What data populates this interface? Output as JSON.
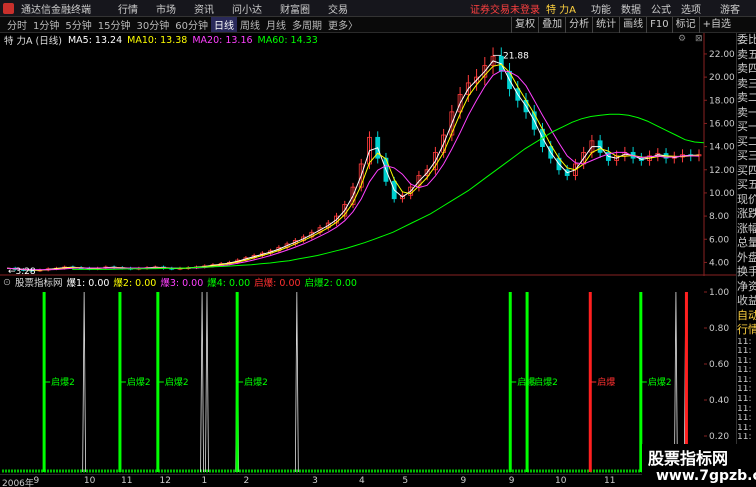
{
  "app": {
    "title": "通达信金融终端",
    "menus": [
      "行情",
      "市场",
      "资讯",
      "问小达",
      "财富圈",
      "交易"
    ],
    "login_status": "证券交易未登录",
    "stock_name": "特 力A",
    "right_menus": [
      "功能",
      "数据",
      "公式",
      "选项"
    ],
    "guest": "游客"
  },
  "toolbar": {
    "periods": [
      "分时",
      "1分钟",
      "5分钟",
      "15分钟",
      "30分钟",
      "60分钟",
      "日线",
      "周线",
      "月线",
      "多周期",
      "更多"
    ],
    "active_period": "日线",
    "more_suffix": "〉",
    "tools": [
      "复权",
      "叠加",
      "分析",
      "统计",
      "画线",
      "F10",
      "标记",
      "+自选"
    ]
  },
  "info": {
    "stock_label": "特 力A (日线)",
    "ma5": "MA5: 13.24",
    "ma10": "MA10: 13.38",
    "ma20": "MA20: 13.16",
    "ma60": "MA60: 14.33",
    "colors": {
      "ma5": "#ffffff",
      "ma10": "#ffff00",
      "ma20": "#ff40ff",
      "ma60": "#00ff00"
    }
  },
  "price_chart": {
    "type": "line",
    "ylim": [
      3.0,
      22.6
    ],
    "y_ticks": [
      "22.00",
      "20.00",
      "18.00",
      "16.00",
      "14.00",
      "12.00",
      "10.00",
      "8.00",
      "6.00",
      "4.00"
    ],
    "y_tick_values": [
      22,
      20,
      18,
      16,
      14,
      12,
      10,
      8,
      6,
      4
    ],
    "high_label": "21.88",
    "high_value": 21.88,
    "low_label": "3.28",
    "low_value": 3.28,
    "close_series": [
      3.5,
      3.4,
      3.35,
      3.3,
      3.35,
      3.45,
      3.5,
      3.6,
      3.55,
      3.5,
      3.45,
      3.5,
      3.6,
      3.55,
      3.5,
      3.45,
      3.5,
      3.55,
      3.6,
      3.5,
      3.45,
      3.5,
      3.55,
      3.6,
      3.7,
      3.8,
      3.9,
      4.0,
      4.2,
      4.4,
      4.6,
      4.8,
      5.0,
      5.3,
      5.6,
      5.9,
      6.2,
      6.6,
      7.0,
      7.4,
      8.0,
      9.0,
      10.5,
      12.5,
      14.8,
      13.0,
      11.0,
      9.5,
      9.8,
      10.5,
      11.5,
      12.0,
      13.5,
      15.0,
      17.0,
      18.5,
      19.5,
      20.0,
      21.0,
      21.8,
      20.5,
      19.0,
      18.0,
      17.0,
      15.5,
      14.0,
      13.0,
      12.0,
      11.5,
      12.5,
      13.5,
      14.5,
      13.5,
      12.8,
      13.2,
      13.5,
      13.0,
      12.8,
      13.2,
      13.4,
      13.0,
      13.1,
      13.3,
      13.2,
      13.3
    ],
    "ma60_series": [
      3.4,
      3.4,
      3.4,
      3.4,
      3.4,
      3.42,
      3.44,
      3.45,
      3.46,
      3.47,
      3.48,
      3.5,
      3.52,
      3.55,
      3.58,
      3.62,
      3.66,
      3.7,
      3.75,
      3.8,
      3.88,
      3.95,
      4.05,
      4.15,
      4.3,
      4.45,
      4.6,
      4.8,
      5.0,
      5.2,
      5.45,
      5.7,
      6.0,
      6.3,
      6.6,
      7.0,
      7.4,
      7.8,
      8.2,
      8.7,
      9.2,
      9.7,
      10.2,
      10.8,
      11.4,
      12.0,
      12.6,
      13.2,
      13.8,
      14.3,
      14.8,
      15.3,
      15.7,
      16.1,
      16.4,
      16.6,
      16.7,
      16.8,
      16.8,
      16.7,
      16.5,
      16.2,
      15.8,
      15.4,
      15.0,
      14.6,
      14.4,
      14.33
    ],
    "ma60_x_start": 0.1
  },
  "indicator": {
    "name": "股票指标网",
    "values": [
      {
        "label": "爆1: 0.00",
        "color": "#ffffff"
      },
      {
        "label": "爆2: 0.00",
        "color": "#ffff00"
      },
      {
        "label": "爆3: 0.00",
        "color": "#ff40ff"
      },
      {
        "label": "爆4: 0.00",
        "color": "#00ff00"
      },
      {
        "label": "启爆: 0.00",
        "color": "#ff3030"
      },
      {
        "label": "启爆2: 0.00",
        "color": "#00ff00"
      }
    ],
    "y_ticks": [
      "1.00",
      "0.80",
      "0.60",
      "0.40",
      "0.20"
    ],
    "y_tick_values": [
      1.0,
      0.8,
      0.6,
      0.4,
      0.2
    ],
    "signal_text": "启爆2",
    "signal_text_red": "启爆",
    "green_bars": [
      0.06,
      0.168,
      0.222,
      0.335,
      0.724,
      0.748,
      0.91
    ],
    "red_bars": [
      0.838,
      0.975
    ],
    "white_spikes": [
      0.117,
      0.285,
      0.292,
      0.335,
      0.42,
      0.96,
      0.974
    ],
    "labels": [
      {
        "x": 0.06,
        "text": "启爆2",
        "red": false
      },
      {
        "x": 0.168,
        "text": "启爆2",
        "red": false
      },
      {
        "x": 0.222,
        "text": "启爆2",
        "red": false
      },
      {
        "x": 0.335,
        "text": "启爆2",
        "red": false
      },
      {
        "x": 0.724,
        "text": "启爆",
        "red": false
      },
      {
        "x": 0.748,
        "text": "启爆2",
        "red": false
      },
      {
        "x": 0.838,
        "text": "启爆",
        "red": true
      },
      {
        "x": 0.91,
        "text": "启爆2",
        "red": false
      }
    ]
  },
  "time_axis": {
    "labels": [
      {
        "x": 0.0,
        "text": "2006年"
      },
      {
        "x": 0.045,
        "text": "9"
      },
      {
        "x": 0.117,
        "text": "10"
      },
      {
        "x": 0.17,
        "text": "11"
      },
      {
        "x": 0.225,
        "text": "12"
      },
      {
        "x": 0.285,
        "text": "1"
      },
      {
        "x": 0.345,
        "text": "2"
      },
      {
        "x": 0.443,
        "text": "3"
      },
      {
        "x": 0.51,
        "text": "4"
      },
      {
        "x": 0.572,
        "text": "5"
      },
      {
        "x": 0.655,
        "text": "9"
      },
      {
        "x": 0.724,
        "text": "9"
      },
      {
        "x": 0.79,
        "text": "10"
      },
      {
        "x": 0.86,
        "text": "11"
      }
    ]
  },
  "right_panel": {
    "items": [
      "委比",
      "卖五",
      "卖四",
      "卖三",
      "卖二",
      "卖一",
      "买一",
      "买二",
      "买三",
      "买四",
      "买五",
      "现价",
      "涨跌",
      "涨幅",
      "总量",
      "外盘",
      "换手",
      "净资",
      "收益",
      "自动",
      "行情",
      "11:",
      "11:",
      "11:",
      "11:",
      "11:",
      "11:",
      "11:",
      "11:",
      "11:",
      "11:",
      "11:"
    ]
  },
  "watermark": {
    "line1": "股票指标网",
    "line2": "www.7gpzb.com"
  }
}
